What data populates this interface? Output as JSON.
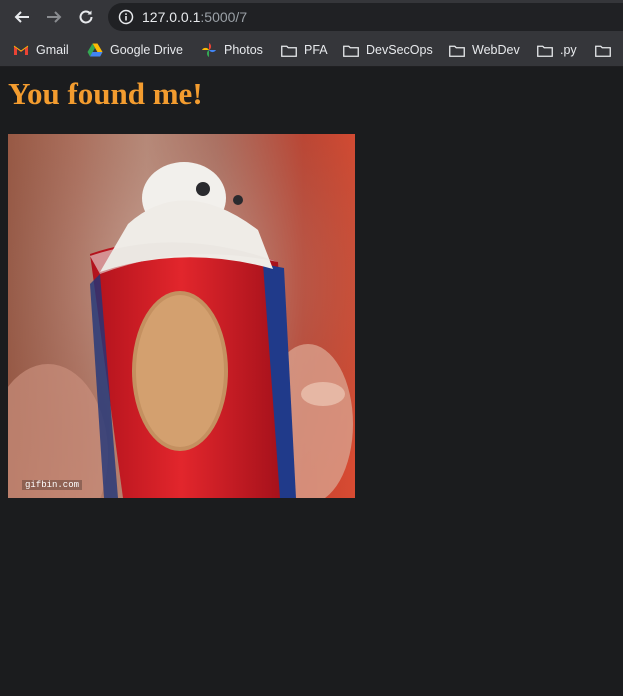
{
  "browser": {
    "url_host": "127.0.0.1",
    "url_path": ":5000/7",
    "bookmarks": [
      {
        "label": "Gmail",
        "icon": "gmail-icon"
      },
      {
        "label": "Google Drive",
        "icon": "google-drive-icon"
      },
      {
        "label": "Photos",
        "icon": "google-photos-icon"
      },
      {
        "label": "PFA",
        "icon": "folder-icon"
      },
      {
        "label": "DevSecOps",
        "icon": "folder-icon"
      },
      {
        "label": "WebDev",
        "icon": "folder-icon"
      },
      {
        "label": ".py",
        "icon": "folder-icon"
      }
    ]
  },
  "page": {
    "heading": "You found me!",
    "image_watermark": "gifbin.com"
  },
  "colors": {
    "heading": "#f39c2f",
    "background": "#1b1c1e",
    "toolbar": "#35363a"
  }
}
